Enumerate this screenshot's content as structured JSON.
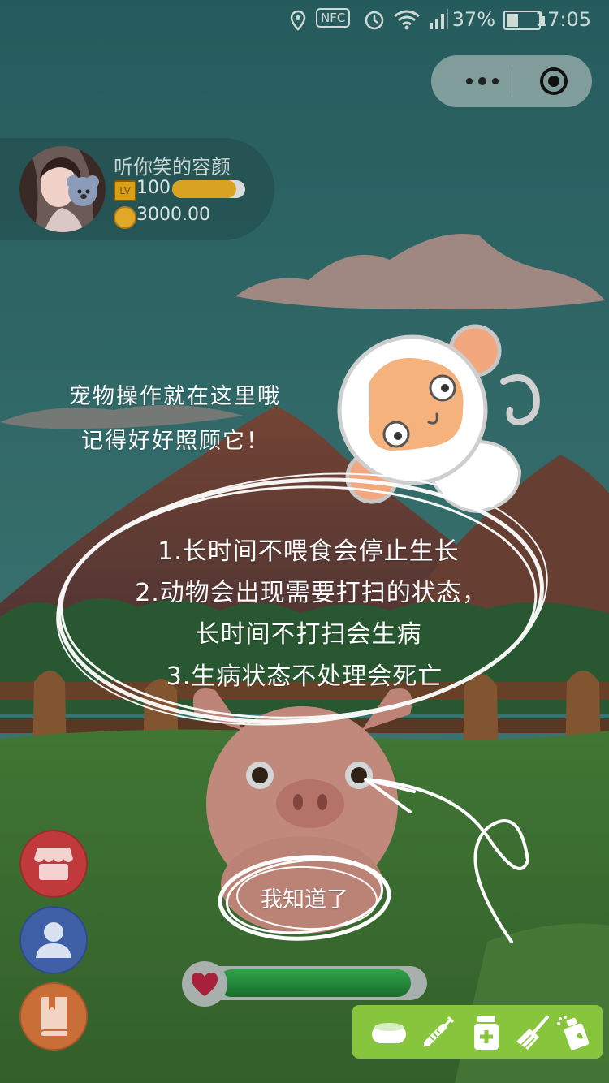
{
  "status_bar": {
    "nfc_label": "NFC",
    "battery_percent": "37%",
    "battery_level": 0.37,
    "time": "17:05",
    "icons": [
      "location-icon",
      "nfc-icon",
      "alarm-icon",
      "wifi-icon",
      "signal-icon",
      "battery-icon"
    ]
  },
  "capsule": {
    "icons": [
      "more-dots-icon",
      "close-target-icon"
    ]
  },
  "profile": {
    "nickname": "听你笑的容颜",
    "level_badge": "LV",
    "level": "100",
    "exp_fraction": 0.88,
    "coins": "3000.00"
  },
  "tutorial": {
    "tip_line1": "宠物操作就在这里哦",
    "tip_line2": "记得好好照顾它！",
    "rules": [
      "1.长时间不喂食会停止生长",
      "2.动物会出现需要打扫的状态，",
      "长时间不打扫会生病",
      "3.生病状态不处理会死亡"
    ],
    "confirm_label": "我知道了"
  },
  "side_buttons": [
    {
      "name": "store",
      "icon": "store-icon",
      "color": "#c0393b"
    },
    {
      "name": "profile",
      "icon": "user-icon",
      "color": "#3f5fa6"
    },
    {
      "name": "guide",
      "icon": "book-icon",
      "color": "#c96e36"
    }
  ],
  "health": {
    "icon": "heart-icon",
    "fraction": 0.95
  },
  "toolbar": {
    "color": "#86c53c",
    "tools": [
      {
        "name": "feed",
        "icon": "food-bowl-icon"
      },
      {
        "name": "injection",
        "icon": "syringe-icon"
      },
      {
        "name": "medicine",
        "icon": "medicine-bottle-icon"
      },
      {
        "name": "clean",
        "icon": "broom-icon"
      },
      {
        "name": "spray",
        "icon": "spray-icon"
      }
    ]
  },
  "colors": {
    "sky_top": "#2f6a6d",
    "sky_bottom": "#4c8f8c",
    "overlay": "rgba(0,0,0,0.35)",
    "chalk": "#ffffff"
  }
}
